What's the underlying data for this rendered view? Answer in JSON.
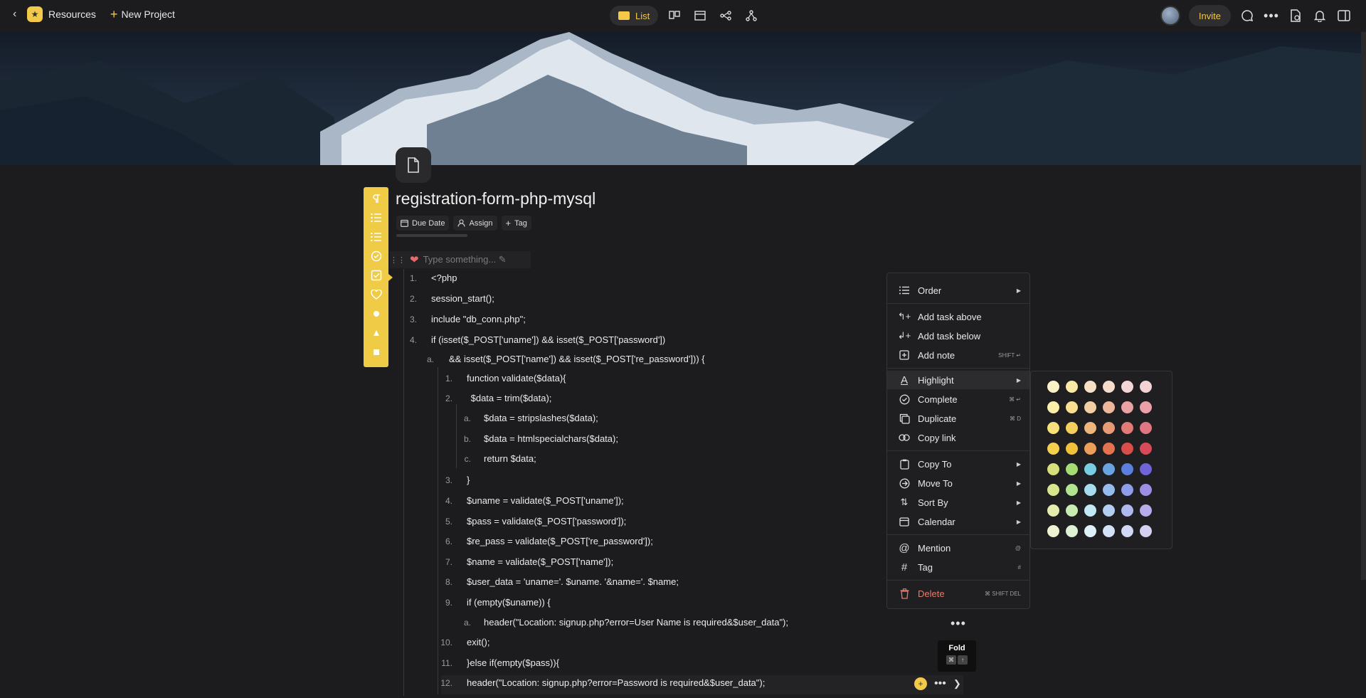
{
  "topbar": {
    "back_icon": "chevron-left-icon",
    "breadcrumb": "Resources",
    "new_project": "New Project",
    "views": {
      "active": "List"
    },
    "invite": "Invite"
  },
  "doc": {
    "title": "registration-form-php-mysql",
    "due_date": "Due Date",
    "assign": "Assign",
    "tag": "Tag",
    "placeholder": "Type something... ✎"
  },
  "code_lines": [
    {
      "n": "1.",
      "text": "<?php"
    },
    {
      "n": "2.",
      "text": "session_start();"
    },
    {
      "n": "3.",
      "text": "include \"db_conn.php\";"
    },
    {
      "n": "4.",
      "text": "if (isset($_POST['uname']) && isset($_POST['password'])"
    },
    {
      "n": "a.",
      "text": "&& isset($_POST['name']) && isset($_POST['re_password'])) {"
    },
    {
      "n": "1.",
      "text": "function validate($data){"
    },
    {
      "n": "2.",
      "text": " $data = trim($data);"
    },
    {
      "n": "a.",
      "text": "$data = stripslashes($data);"
    },
    {
      "n": "b.",
      "text": "$data = htmlspecialchars($data);"
    },
    {
      "n": "c.",
      "text": "return $data;"
    },
    {
      "n": "3.",
      "text": "}"
    },
    {
      "n": "4.",
      "text": "$uname = validate($_POST['uname']);"
    },
    {
      "n": "5.",
      "text": "$pass = validate($_POST['password']);"
    },
    {
      "n": "6.",
      "text": "$re_pass = validate($_POST['re_password']);"
    },
    {
      "n": "7.",
      "text": "$name = validate($_POST['name']);"
    },
    {
      "n": "8.",
      "text": "$user_data = 'uname='. $uname. '&name='. $name;"
    },
    {
      "n": "9.",
      "text": "if (empty($uname)) {"
    },
    {
      "n": "a.",
      "text": "header(\"Location: signup.php?error=User Name is required&$user_data\");"
    },
    {
      "n": "10.",
      "text": "exit();"
    },
    {
      "n": "11.",
      "text": "}else if(empty($pass)){"
    },
    {
      "n": "12.",
      "text": "header(\"Location: signup.php?error=Password is required&$user_data\");"
    }
  ],
  "context_menu": {
    "order": "Order",
    "add_task_above": "Add task above",
    "add_task_below": "Add task below",
    "add_note": "Add note",
    "add_note_kbd": "SHIFT ↵",
    "highlight": "Highlight",
    "complete": "Complete",
    "complete_kbd": "⌘ ↵",
    "duplicate": "Duplicate",
    "duplicate_kbd": "⌘ D",
    "copy_link": "Copy link",
    "copy_to": "Copy To",
    "move_to": "Move To",
    "sort_by": "Sort By",
    "calendar": "Calendar",
    "mention": "Mention",
    "mention_kbd": "@",
    "tag": "Tag",
    "tag_kbd": "#",
    "delete": "Delete",
    "delete_kbd": "⌘ SHIFT DEL"
  },
  "palette_colors": [
    [
      "#fbf3c8",
      "#fbeaa6",
      "#f6e0c6",
      "#f5dccb",
      "#f3d6d6",
      "#f5d2d4"
    ],
    [
      "#fbf0a9",
      "#f8e08f",
      "#f2cfa2",
      "#eeb79c",
      "#e9a2a3",
      "#eaa0a6"
    ],
    [
      "#f8e17a",
      "#f5cf5d",
      "#eeb57c",
      "#e79a76",
      "#e27a76",
      "#e27582"
    ],
    [
      "#f5d04c",
      "#f2c13a",
      "#eb9f59",
      "#e3724e",
      "#d94d4a",
      "#d84a57"
    ],
    [
      "#d7df7a",
      "#a6dc73",
      "#79cde3",
      "#6aa4e0",
      "#5b7fdc",
      "#6f64d8"
    ],
    [
      "#d8e48e",
      "#b2e492",
      "#a7dcef",
      "#95bcec",
      "#8d9de8",
      "#9a8fe4"
    ],
    [
      "#e4ecae",
      "#c9ecb1",
      "#c2e8f4",
      "#b2cff1",
      "#aeb9ef",
      "#b4aceb"
    ],
    [
      "#eef3d3",
      "#dff2d5",
      "#dff1f8",
      "#d3e2f6",
      "#d1d8f5",
      "#d4d0f3"
    ]
  ],
  "tooltip": {
    "title": "Fold",
    "key1": "⌘",
    "key2": "↑"
  }
}
